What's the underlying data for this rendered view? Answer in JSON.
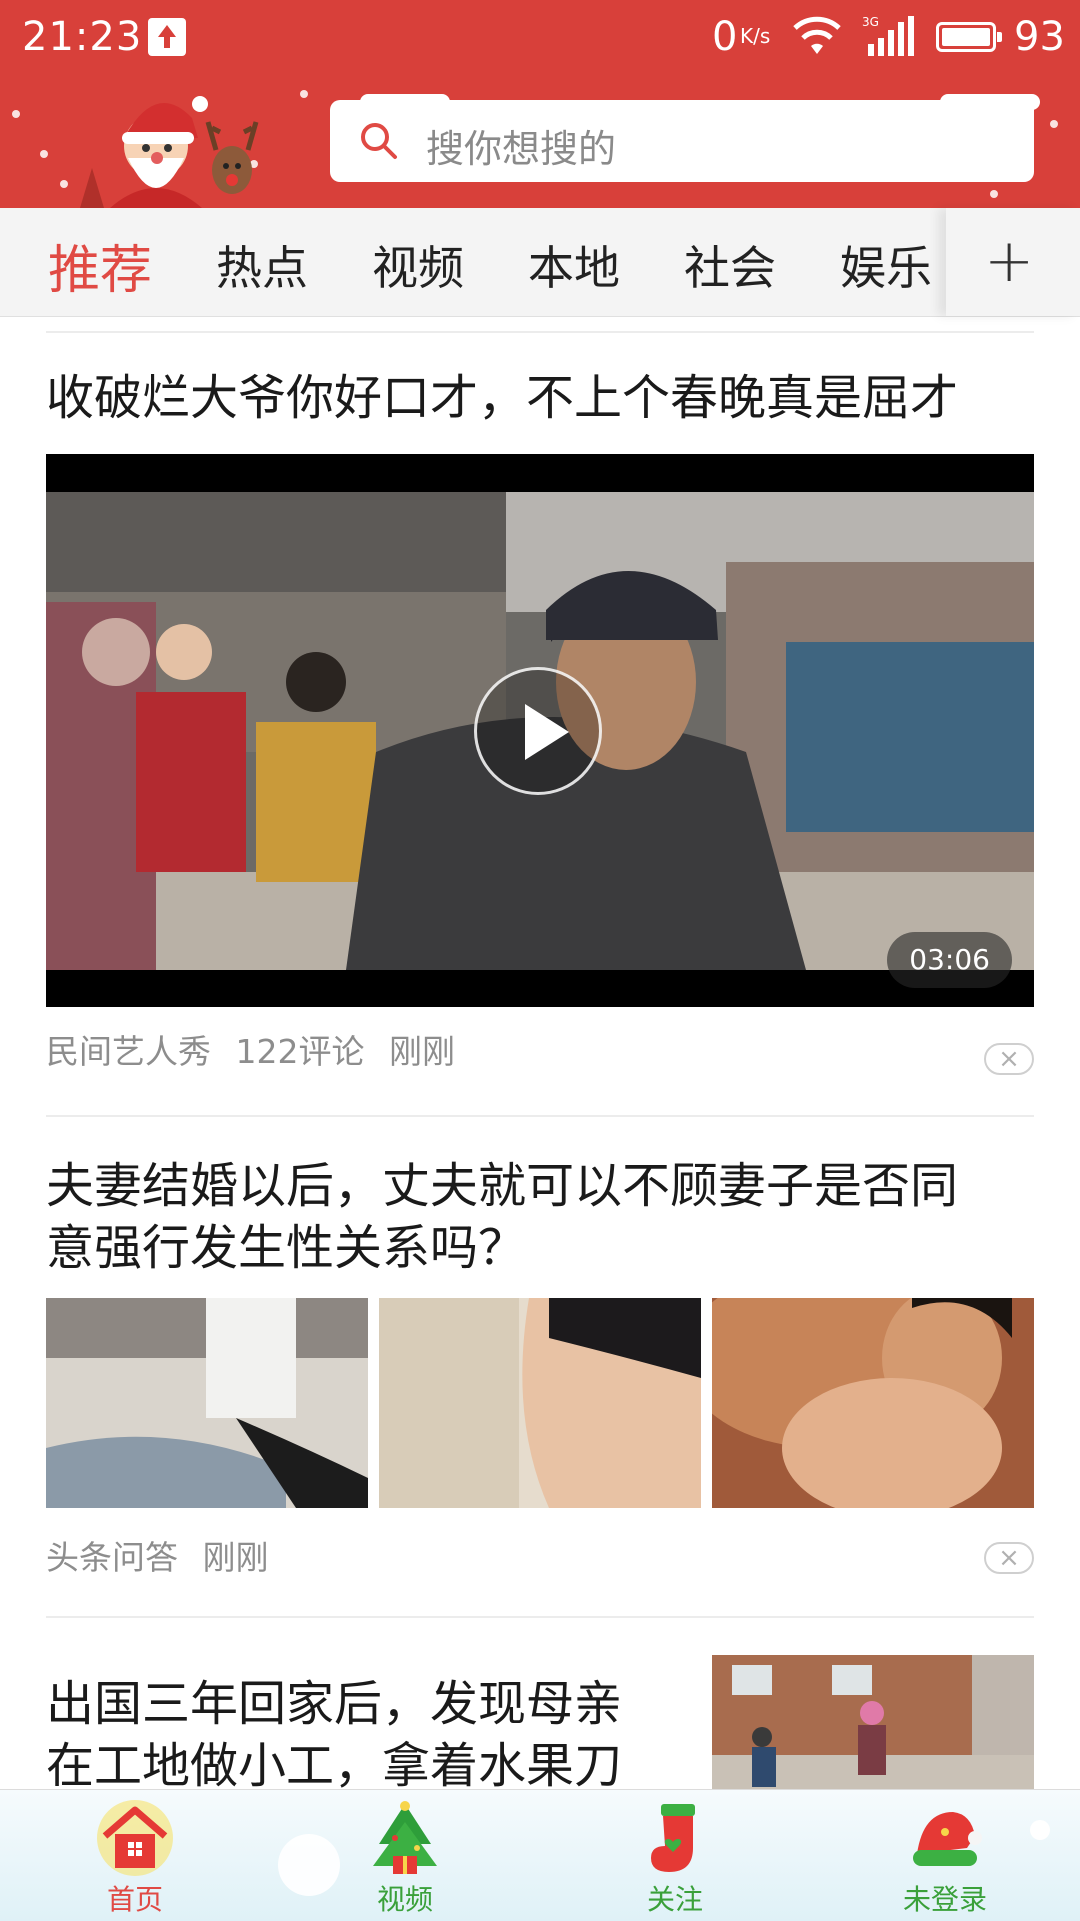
{
  "status_bar": {
    "time": "21:23",
    "net_speed": "0",
    "net_unit": "K/s",
    "signal_type": "3G",
    "battery": "93"
  },
  "search": {
    "placeholder": "搜你想搜的"
  },
  "tabs": [
    {
      "label": "推荐",
      "active": true
    },
    {
      "label": "热点"
    },
    {
      "label": "视频"
    },
    {
      "label": "本地"
    },
    {
      "label": "社会"
    },
    {
      "label": "娱乐"
    }
  ],
  "tab_add_label": "+",
  "feed": {
    "items": [
      {
        "title": "收破烂大爷你好口才，不上个春晚真是屈才",
        "duration": "03:06",
        "source": "民间艺人秀",
        "comments": "122评论",
        "time": "刚刚"
      },
      {
        "title_line1": "夫妻结婚以后，丈夫就可以不顾妻子是否同",
        "title_line2": "意强行发生性关系吗？",
        "source": "头条问答",
        "time": "刚刚"
      },
      {
        "title_line1": "出国三年回家后，发现母亲",
        "title_line2": "在工地做小工，拿着水果刀"
      }
    ],
    "dismiss_symbol": "×"
  },
  "bottom_nav": [
    {
      "label": "首页",
      "icon": "home-icon",
      "color": "#e04a44"
    },
    {
      "label": "视频",
      "icon": "christmas-tree-icon",
      "color": "#3aa03a"
    },
    {
      "label": "关注",
      "icon": "stocking-icon",
      "color": "#3aa03a"
    },
    {
      "label": "未登录",
      "icon": "santa-hat-icon",
      "color": "#3aa03a"
    }
  ],
  "colors": {
    "header_red": "#d8403a",
    "active_tab": "#e04a44",
    "meta_gray": "#8d8d8d"
  }
}
